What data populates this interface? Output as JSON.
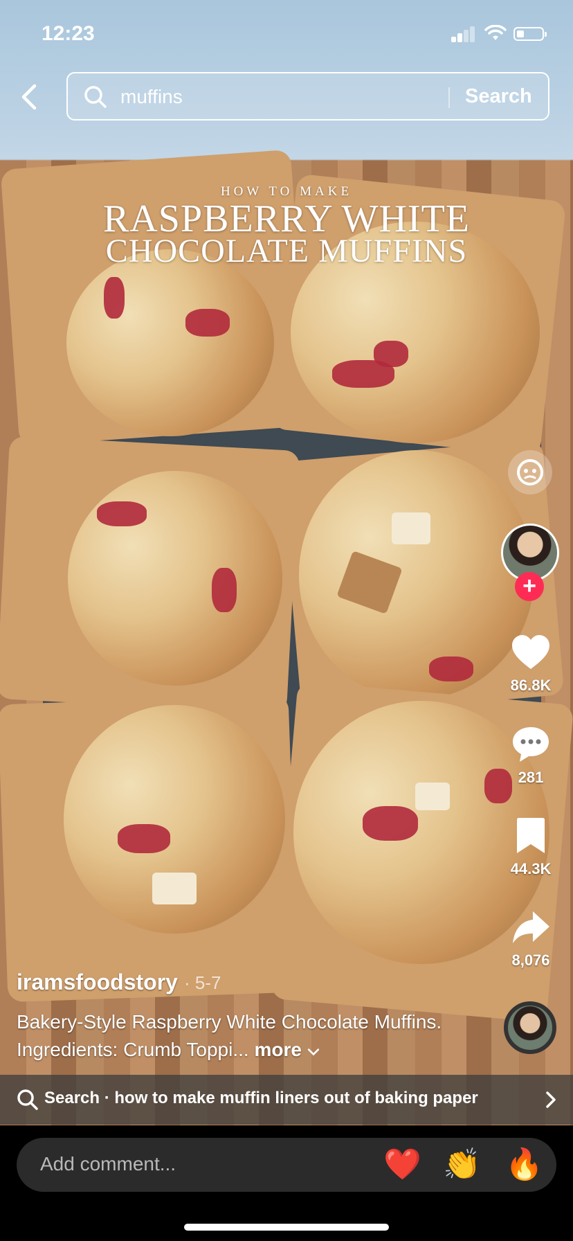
{
  "status_bar": {
    "time": "12:23"
  },
  "search": {
    "query": "muffins",
    "button_label": "Search"
  },
  "video_overlay": {
    "small": "HOW TO MAKE",
    "line1": "RASPBERRY WHITE",
    "line2": "CHOCOLATE MUFFINS"
  },
  "rail": {
    "likes": "86.8K",
    "comments": "281",
    "saves": "44.3K",
    "shares": "8,076",
    "follow_glyph": "+"
  },
  "post": {
    "username": "iramsfoodstory",
    "date": "· 5-7",
    "caption": "Bakery-Style Raspberry White Chocolate Muffins. Ingredients: Crumb Toppi...",
    "more_label": "more"
  },
  "related_search": {
    "text": "Search · how to make muffin liners out of baking paper"
  },
  "comment_bar": {
    "placeholder": "Add comment...",
    "emojis": [
      "❤️",
      "👏",
      "🔥"
    ]
  },
  "colors": {
    "accent": "#fe2c55",
    "comment_box": "#2b2b2b"
  }
}
